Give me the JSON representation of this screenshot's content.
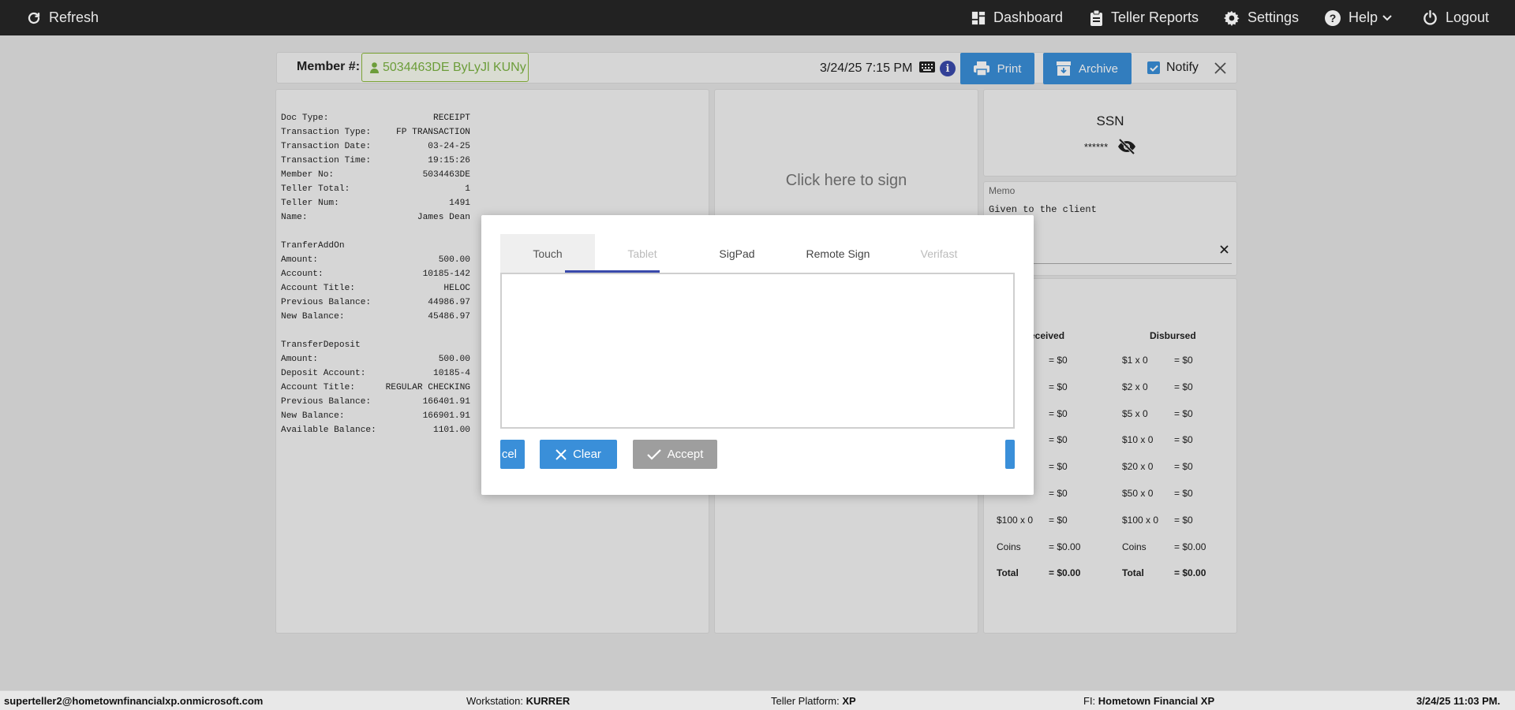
{
  "topnav": {
    "refresh": "Refresh",
    "dashboard": "Dashboard",
    "teller_reports": "Teller Reports",
    "settings": "Settings",
    "help": "Help",
    "logout": "Logout"
  },
  "header": {
    "member_label": "Member #:",
    "member_value": "5034463DE ByLyJl KUNy",
    "datetime": "3/24/25 7:15 PM",
    "print": "Print",
    "archive": "Archive",
    "notify": "Notify",
    "notify_checked": true
  },
  "receipt": [
    [
      "Doc Type:",
      "RECEIPT"
    ],
    [
      "Transaction Type:",
      "FP TRANSACTION"
    ],
    [
      "Transaction Date:",
      "03-24-25"
    ],
    [
      "Transaction Time:",
      "19:15:26"
    ],
    [
      "Member No:",
      "5034463DE"
    ],
    [
      "Teller Total:",
      "1"
    ],
    [
      "Teller Num:",
      "1491"
    ],
    [
      "Name:",
      "James Dean"
    ],
    [
      "",
      ""
    ],
    [
      "TranferAddOn",
      ""
    ],
    [
      "Amount:",
      "500.00"
    ],
    [
      "Account:",
      "10185-142"
    ],
    [
      "Account Title:",
      "HELOC"
    ],
    [
      "Previous Balance:",
      "44986.97"
    ],
    [
      "New Balance:",
      "45486.97"
    ],
    [
      "",
      ""
    ],
    [
      "TransferDeposit",
      ""
    ],
    [
      "Amount:",
      "500.00"
    ],
    [
      "Deposit Account:",
      "10185-4"
    ],
    [
      "Account Title:",
      "REGULAR CHECKING"
    ],
    [
      "Previous Balance:",
      "166401.91"
    ],
    [
      "New Balance:",
      "166901.91"
    ],
    [
      "Available Balance:",
      "1101.00"
    ]
  ],
  "signature_panel": {
    "click_to_sign": "Click here to sign"
  },
  "ssn": {
    "title": "SSN",
    "masked": "******"
  },
  "memo": {
    "label": "Memo",
    "value": "Given to the client"
  },
  "cash": {
    "received_header": "eceived",
    "disbursed_header": "Disbursed",
    "received_values": [
      "= $0",
      "= $0",
      "= $0",
      "= $0",
      "= $0",
      "= $0",
      "= $0",
      "= $0.00",
      "= $0.00"
    ],
    "received_labels": [
      "",
      "",
      "",
      "",
      "",
      "",
      "$100 x 0",
      "Coins",
      "Total"
    ],
    "disbursed_labels": [
      "$1 x 0",
      "$2 x 0",
      "$5 x 0",
      "$10 x 0",
      "$20 x 0",
      "$50 x 0",
      "$100 x 0",
      "Coins",
      "Total"
    ],
    "disbursed_values": [
      "= $0",
      "= $0",
      "= $0",
      "= $0",
      "= $0",
      "= $0",
      "= $0",
      "= $0.00",
      "= $0.00"
    ]
  },
  "modal": {
    "tabs": [
      "Touch",
      "Tablet",
      "SigPad",
      "Remote Sign",
      "Verifast"
    ],
    "active_tab": "Touch",
    "cancel_partial": "cel",
    "clear": "Clear",
    "accept": "Accept"
  },
  "footer": {
    "user": "superteller2@hometownfinancialxp.onmicrosoft.com",
    "workstation_label": "Workstation:",
    "workstation": "KURRER",
    "platform_label": "Teller Platform:",
    "platform": "XP",
    "fi_label": "FI:",
    "fi": "Hometown Financial XP",
    "datetime": "3/24/25 11:03 PM."
  },
  "colors": {
    "nav_bg": "#222222",
    "accent_blue": "#3a8fd9",
    "member_green": "#7cb342",
    "tab_underline": "#3949ab",
    "accept_gray": "#9e9e9e"
  }
}
